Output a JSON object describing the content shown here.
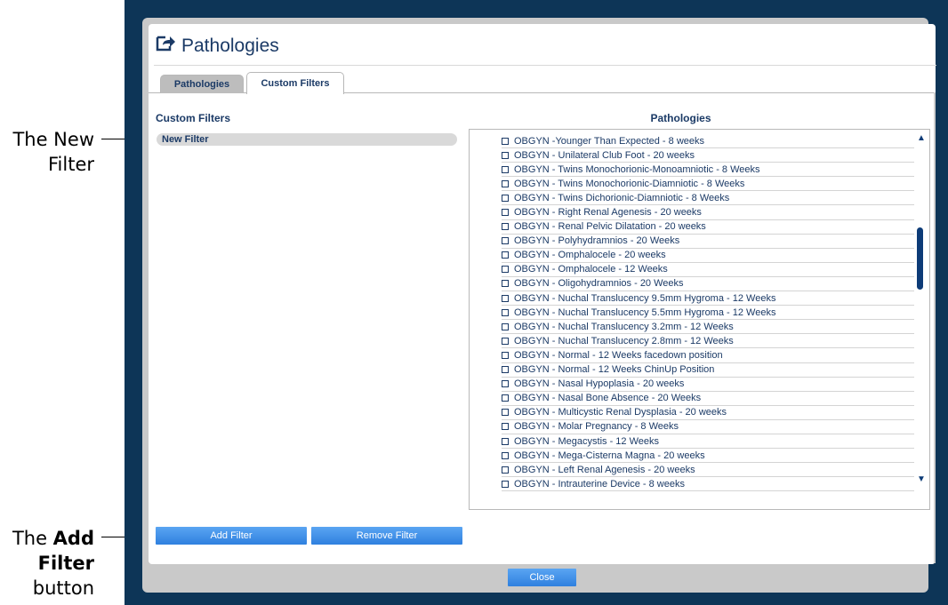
{
  "annotations": {
    "new_filter_line1": "The New",
    "new_filter_line2": "Filter",
    "add_filter_prefix": "The ",
    "add_filter_bold1": "Add",
    "add_filter_bold2": "Filter",
    "add_filter_suffix": "button"
  },
  "dialog": {
    "title": "Pathologies",
    "title_icon": "export-arrow-icon",
    "tabs": [
      {
        "label": "Pathologies",
        "active": false
      },
      {
        "label": "Custom Filters",
        "active": true
      }
    ],
    "custom_filters_heading": "Custom Filters",
    "pathologies_heading": "Pathologies",
    "custom_filters": [
      "New Filter"
    ],
    "pathologies": [
      "OBGYN -Younger Than Expected - 8 weeks",
      "OBGYN - Unilateral Club Foot - 20 weeks",
      "OBGYN - Twins Monochorionic-Monoamniotic - 8 Weeks",
      "OBGYN - Twins Monochorionic-Diamniotic - 8 Weeks",
      "OBGYN - Twins Dichorionic-Diamniotic - 8 Weeks",
      "OBGYN - Right Renal Agenesis - 20 weeks",
      "OBGYN - Renal Pelvic Dilatation - 20 weeks",
      "OBGYN - Polyhydramnios - 20 Weeks",
      "OBGYN - Omphalocele - 20 weeks",
      "OBGYN - Omphalocele - 12 Weeks",
      "OBGYN - Oligohydramnios - 20 Weeks",
      "OBGYN - Nuchal Translucency 9.5mm Hygroma - 12 Weeks",
      "OBGYN - Nuchal Translucency 5.5mm Hygroma - 12 Weeks",
      "OBGYN - Nuchal Translucency 3.2mm - 12 Weeks",
      "OBGYN - Nuchal Translucency 2.8mm - 12 Weeks",
      "OBGYN - Normal - 12 Weeks facedown position",
      "OBGYN - Normal - 12 Weeks ChinUp Position",
      "OBGYN - Nasal Hypoplasia - 20 weeks",
      "OBGYN - Nasal Bone Absence - 20 Weeks",
      "OBGYN - Multicystic Renal Dysplasia - 20 weeks",
      "OBGYN - Molar Pregnancy - 8 Weeks",
      "OBGYN - Megacystis - 12 Weeks",
      "OBGYN - Mega-Cisterna Magna - 20 weeks",
      "OBGYN - Left Renal Agenesis - 20 weeks",
      "OBGYN - Intrauterine Device - 8 weeks"
    ],
    "buttons": {
      "add_filter": "Add Filter",
      "remove_filter": "Remove Filter",
      "close": "Close"
    },
    "scroll_up_icon": "▲",
    "scroll_down_icon": "▼",
    "colors": {
      "frame": "#0d3557",
      "accent_text": "#1b3a66",
      "button": "#3d8ee8"
    }
  }
}
